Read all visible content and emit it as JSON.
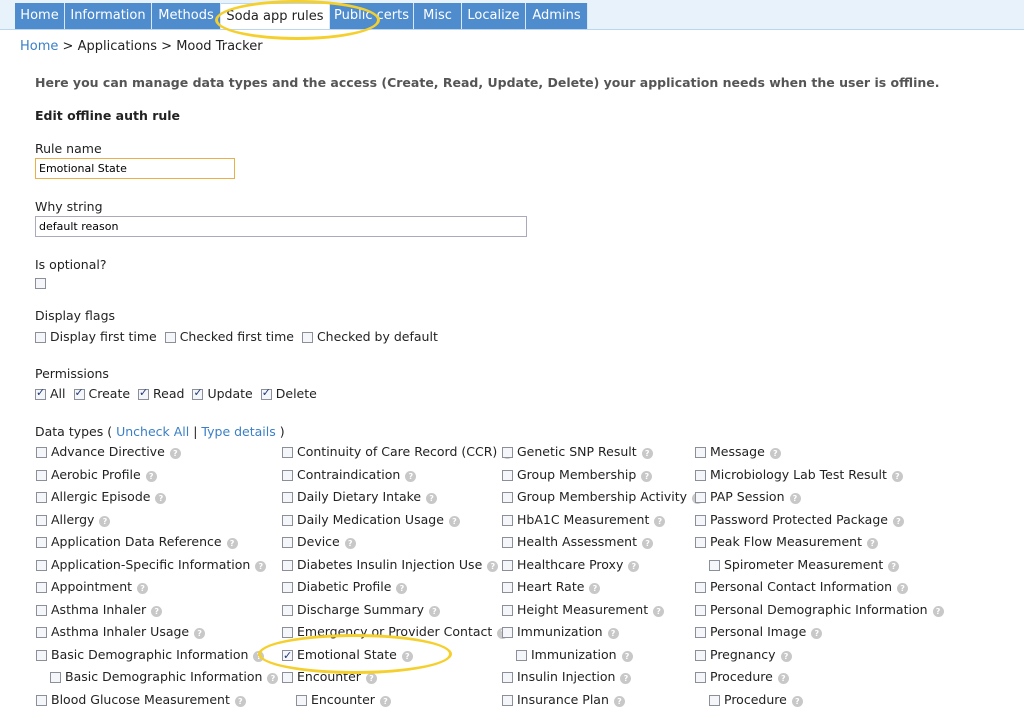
{
  "nav": {
    "tabs": [
      "Home",
      "Information",
      "Methods",
      "Soda app rules",
      "Public certs",
      "Misc",
      "Localize",
      "Admins"
    ],
    "active": "Soda app rules"
  },
  "breadcrumb": {
    "home": "Home",
    "sep": ">",
    "applications": "Applications",
    "current": "Mood Tracker"
  },
  "intro": "Here you can manage data types and the access (Create, Read, Update, Delete) your application needs when the user is offline.",
  "section_title": "Edit offline auth rule",
  "form": {
    "rule_name_label": "Rule name",
    "rule_name_value": "Emotional State",
    "why_label": "Why string",
    "why_value": "default reason",
    "optional_label": "Is optional?",
    "display_flags_label": "Display flags",
    "display_flags": [
      {
        "label": "Display first time",
        "checked": false
      },
      {
        "label": "Checked first time",
        "checked": false
      },
      {
        "label": "Checked by default",
        "checked": false
      }
    ],
    "permissions_label": "Permissions",
    "permissions": [
      {
        "label": "All",
        "checked": true
      },
      {
        "label": "Create",
        "checked": true
      },
      {
        "label": "Read",
        "checked": true
      },
      {
        "label": "Update",
        "checked": true
      },
      {
        "label": "Delete",
        "checked": true
      }
    ]
  },
  "data_types": {
    "label": "Data types (",
    "uncheck_all": "Uncheck All",
    "pipe": "|",
    "type_details": "Type details",
    "close": ")",
    "columns": [
      [
        {
          "label": "Advance Directive"
        },
        {
          "label": "Aerobic Profile"
        },
        {
          "label": "Allergic Episode"
        },
        {
          "label": "Allergy"
        },
        {
          "label": "Application Data Reference"
        },
        {
          "label": "Application-Specific Information"
        },
        {
          "label": "Appointment"
        },
        {
          "label": "Asthma Inhaler"
        },
        {
          "label": "Asthma Inhaler Usage"
        },
        {
          "label": "Basic Demographic Information"
        },
        {
          "label": "Basic Demographic Information",
          "indent": true
        },
        {
          "label": "Blood Glucose Measurement"
        }
      ],
      [
        {
          "label": "Continuity of Care Record (CCR)"
        },
        {
          "label": "Contraindication"
        },
        {
          "label": "Daily Dietary Intake"
        },
        {
          "label": "Daily Medication Usage"
        },
        {
          "label": "Device"
        },
        {
          "label": "Diabetes Insulin Injection Use"
        },
        {
          "label": "Diabetic Profile"
        },
        {
          "label": "Discharge Summary"
        },
        {
          "label": "Emergency or Provider Contact"
        },
        {
          "label": "Emotional State",
          "checked": true
        },
        {
          "label": "Encounter"
        },
        {
          "label": "Encounter",
          "indent": true
        }
      ],
      [
        {
          "label": "Genetic SNP Result"
        },
        {
          "label": "Group Membership"
        },
        {
          "label": "Group Membership Activity"
        },
        {
          "label": "HbA1C Measurement"
        },
        {
          "label": "Health Assessment"
        },
        {
          "label": "Healthcare Proxy"
        },
        {
          "label": "Heart Rate"
        },
        {
          "label": "Height Measurement"
        },
        {
          "label": "Immunization"
        },
        {
          "label": "Immunization",
          "indent": true
        },
        {
          "label": "Insulin Injection"
        },
        {
          "label": "Insurance Plan"
        }
      ],
      [
        {
          "label": "Message"
        },
        {
          "label": "Microbiology Lab Test Result"
        },
        {
          "label": "PAP Session"
        },
        {
          "label": "Password Protected Package"
        },
        {
          "label": "Peak Flow Measurement"
        },
        {
          "label": "Spirometer Measurement",
          "indent": true
        },
        {
          "label": "Personal Contact Information"
        },
        {
          "label": "Personal Demographic Information"
        },
        {
          "label": "Personal Image"
        },
        {
          "label": "Pregnancy"
        },
        {
          "label": "Procedure"
        },
        {
          "label": "Procedure",
          "indent": true
        }
      ]
    ]
  },
  "colors": {
    "tab": "#4e8cce",
    "link": "#3a7fc6",
    "highlight": "#f5cf2b"
  }
}
